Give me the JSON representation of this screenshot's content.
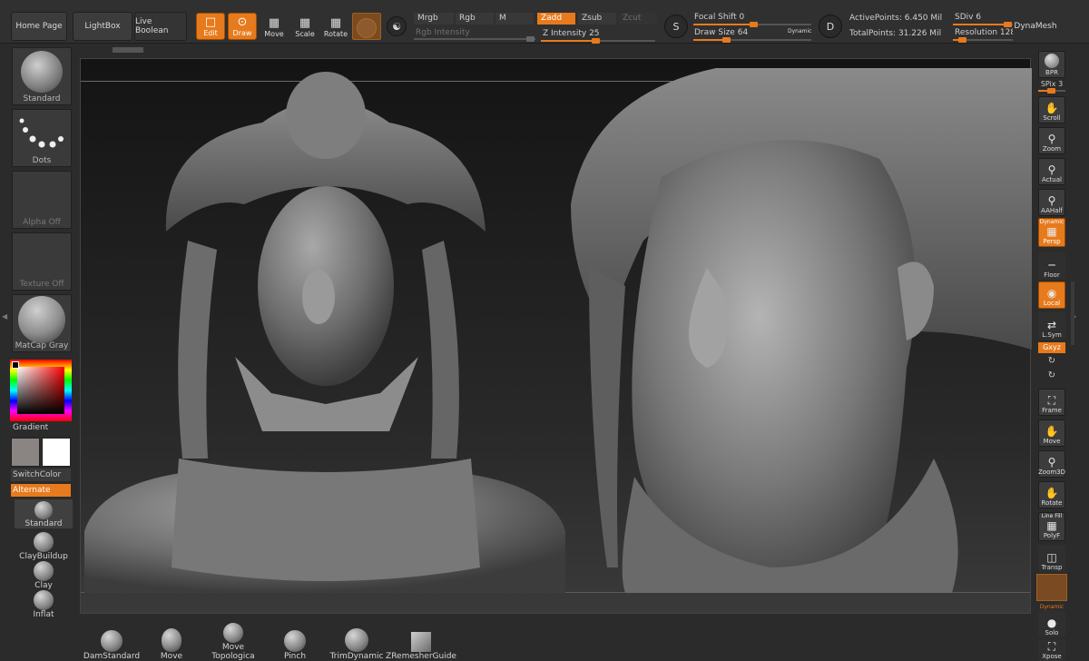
{
  "top": {
    "home_page": "Home Page",
    "lightbox": "LightBox",
    "live_boolean": "Live Boolean",
    "tools": {
      "edit": "Edit",
      "draw": "Draw",
      "move": "Move",
      "scale": "Scale",
      "rotate": "Rotate"
    },
    "modes": {
      "mrgb": "Mrgb",
      "rgb": "Rgb",
      "m": "M",
      "zadd": "Zadd",
      "zsub": "Zsub",
      "zcut": "Zcut"
    },
    "rgb_intensity": "Rgb Intensity",
    "z_intensity_label": "Z Intensity",
    "z_intensity_value": "25",
    "focal_shift_label": "Focal Shift",
    "focal_shift_value": "0",
    "draw_size_label": "Draw Size",
    "draw_size_value": "64",
    "dynamic": "Dynamic",
    "active_points": "ActivePoints: 6.450 Mil",
    "total_points": "TotalPoints: 31.226 Mil",
    "sdiv_label": "SDiv",
    "sdiv_value": "6",
    "resolution_label": "Resolution",
    "resolution_value": "128",
    "dynamesh": "DynaMesh",
    "icon_s": "S",
    "icon_d": "D"
  },
  "left": {
    "standard": "Standard",
    "dots": "Dots",
    "alpha_off": "Alpha Off",
    "texture_off": "Texture Off",
    "matcap_gray": "MatCap Gray",
    "gradient": "Gradient",
    "switch_color": "SwitchColor",
    "alternate": "Alternate",
    "brushes": [
      "Standard",
      "ClayBuildup",
      "Clay",
      "Inflat"
    ]
  },
  "right": {
    "bpr": "BPR",
    "spix_label": "SPix",
    "spix_value": "3",
    "scroll": "Scroll",
    "zoom": "Zoom",
    "actual": "Actual",
    "aahalf": "AAHalf",
    "dynamic": "Dynamic",
    "persp": "Persp",
    "floor": "Floor",
    "local": "Local",
    "lsym": "L.Sym",
    "xyz": "Gxyz",
    "frame": "Frame",
    "move": "Move",
    "zoom3d": "Zoom3D",
    "rotate": "Rotate",
    "line_fill": "Line Fill",
    "polyf": "PolyF",
    "transp": "Transp",
    "dynamic2": "Dynamic",
    "solo": "Solo",
    "xpose": "Xpose"
  },
  "bottom": {
    "brushes": [
      "DamStandard",
      "Move",
      "Move Topologica",
      "Pinch",
      "TrimDynamic",
      "ZRemesherGuide"
    ]
  },
  "colors": {
    "accent": "#e77a1c",
    "main_color": "#8a8483",
    "secondary_color": "#ffffff"
  }
}
